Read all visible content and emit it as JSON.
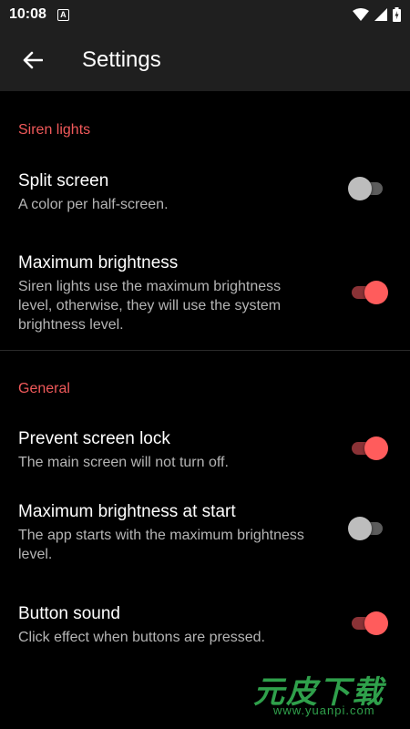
{
  "status_bar": {
    "time": "10:08",
    "notification_icon": "A",
    "icons": [
      "wifi-icon",
      "signal-icon",
      "battery-icon"
    ]
  },
  "app_bar": {
    "back_icon": "arrow-left-icon",
    "title": "Settings"
  },
  "sections": [
    {
      "header": "Siren lights",
      "items": [
        {
          "title": "Split screen",
          "summary": "A color per half-screen.",
          "enabled": false
        },
        {
          "title": "Maximum brightness",
          "summary": "Siren lights use the maximum brightness level, otherwise, they will use the system brightness level.",
          "enabled": true
        }
      ]
    },
    {
      "header": "General",
      "items": [
        {
          "title": "Prevent screen lock",
          "summary": "The main screen will not turn off.",
          "enabled": true
        },
        {
          "title": "Maximum brightness at start",
          "summary": "The app starts with the maximum brightness level.",
          "enabled": false
        },
        {
          "title": "Button sound",
          "summary": "Click effect when buttons are pressed.",
          "enabled": true
        }
      ]
    }
  ],
  "watermark": {
    "name": "元皮下载",
    "url": "www.yuanpi.com"
  },
  "colors": {
    "accent": "#f0595a",
    "toggle_on_thumb": "#ff5c5c",
    "toggle_on_track": "#8a3236",
    "toggle_off_thumb": "#bdbdbd",
    "toggle_off_track": "#5c5c5c",
    "toolbar": "#1f1f1f",
    "background": "#000000"
  }
}
